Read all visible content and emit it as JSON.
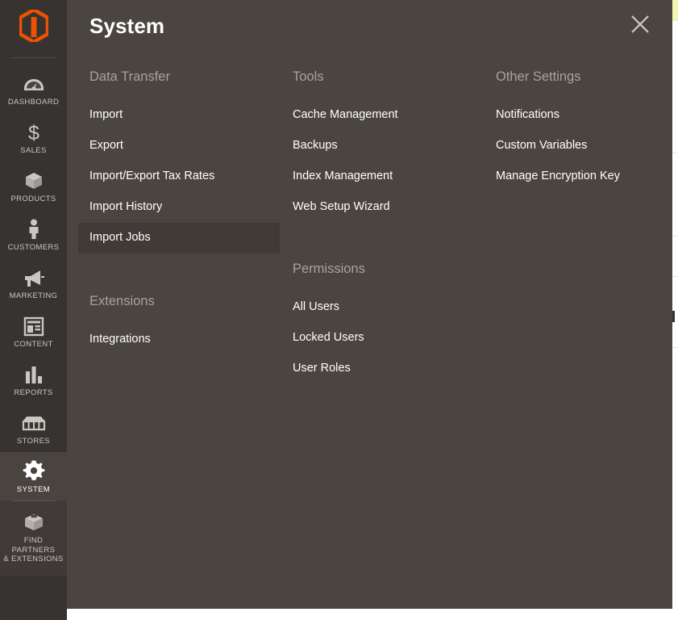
{
  "panel": {
    "title": "System",
    "close_icon": "close-icon"
  },
  "sidebar": {
    "logo_icon": "magento-logo-icon",
    "items": [
      {
        "label": "DASHBOARD",
        "icon": "dashboard-gauge-icon",
        "active": false
      },
      {
        "label": "SALES",
        "icon": "dollar-sign-icon",
        "active": false
      },
      {
        "label": "PRODUCTS",
        "icon": "box-icon",
        "active": false
      },
      {
        "label": "CUSTOMERS",
        "icon": "person-icon",
        "active": false
      },
      {
        "label": "MARKETING",
        "icon": "megaphone-icon",
        "active": false
      },
      {
        "label": "CONTENT",
        "icon": "layout-page-icon",
        "active": false
      },
      {
        "label": "REPORTS",
        "icon": "bar-chart-icon",
        "active": false
      },
      {
        "label": "STORES",
        "icon": "storefront-awning-icon",
        "active": false
      },
      {
        "label": "SYSTEM",
        "icon": "gear-icon",
        "active": true
      }
    ],
    "partners": {
      "label_line1": "FIND PARTNERS",
      "label_line2": "& EXTENSIONS",
      "icon": "open-box-icon"
    }
  },
  "menu": {
    "columns": [
      {
        "groups": [
          {
            "title": "Data Transfer",
            "items": [
              {
                "label": "Import",
                "active": false
              },
              {
                "label": "Export",
                "active": false
              },
              {
                "label": "Import/Export Tax Rates",
                "active": false
              },
              {
                "label": "Import History",
                "active": false
              },
              {
                "label": "Import Jobs",
                "active": true
              }
            ]
          },
          {
            "title": "Extensions",
            "items": [
              {
                "label": "Integrations",
                "active": false
              }
            ]
          }
        ]
      },
      {
        "groups": [
          {
            "title": "Tools",
            "items": [
              {
                "label": "Cache Management",
                "active": false
              },
              {
                "label": "Backups",
                "active": false
              },
              {
                "label": "Index Management",
                "active": false
              },
              {
                "label": "Web Setup Wizard",
                "active": false
              }
            ]
          },
          {
            "title": "Permissions",
            "items": [
              {
                "label": "All Users",
                "active": false
              },
              {
                "label": "Locked Users",
                "active": false
              },
              {
                "label": "User Roles",
                "active": false
              }
            ]
          }
        ]
      },
      {
        "groups": [
          {
            "title": "Other Settings",
            "items": [
              {
                "label": "Notifications",
                "active": false
              },
              {
                "label": "Custom Variables",
                "active": false
              },
              {
                "label": "Manage Encryption Key",
                "active": false
              }
            ]
          }
        ]
      }
    ]
  },
  "colors": {
    "sidebar_bg": "#373330",
    "panel_bg": "#4b4540",
    "active_item_bg": "#413b37",
    "group_title": "#a9a19b",
    "brand_orange": "#eb5202",
    "text": "#ffffff"
  }
}
